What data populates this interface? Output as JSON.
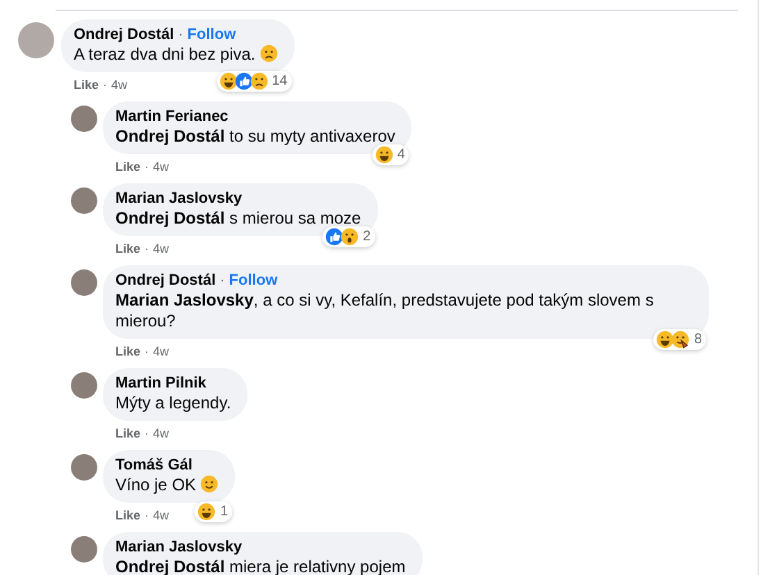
{
  "comment": {
    "author": "Ondrej Dostál",
    "separator": "·",
    "follow": "Follow",
    "text": "A teraz dva dni bez piva.",
    "emoji": {
      "kind": "sad"
    },
    "reactions": [
      {
        "kind": "haha"
      },
      {
        "kind": "like"
      },
      {
        "kind": "sad"
      }
    ],
    "reaction_count": "14",
    "like": "Like",
    "meta_separator": "·",
    "time": "4w",
    "replies": [
      {
        "author": "Martin Ferianec",
        "mention": "Ondrej Dostál",
        "text": "to su myty antivaxerov",
        "reactions": [
          {
            "kind": "haha"
          }
        ],
        "reaction_count": "4",
        "like": "Like",
        "meta_separator": "·",
        "time": "4w"
      },
      {
        "author": "Marian Jaslovsky",
        "mention": "Ondrej Dostál",
        "text": "s mierou sa moze",
        "reactions": [
          {
            "kind": "like"
          },
          {
            "kind": "wow"
          }
        ],
        "reaction_count": "2",
        "like": "Like",
        "meta_separator": "·",
        "time": "4w"
      },
      {
        "author": "Ondrej Dostál",
        "separator": "·",
        "follow": "Follow",
        "mention": "Marian Jaslovsky",
        "text": ", a co si vy, Kefalín, predstavujete pod takým slovem s mierou?",
        "reactions": [
          {
            "kind": "haha"
          },
          {
            "kind": "care"
          }
        ],
        "reaction_count": "8",
        "like": "Like",
        "meta_separator": "·",
        "time": "4w"
      },
      {
        "author": "Martin Pilnik",
        "text": "Mýty a legendy.",
        "like": "Like",
        "meta_separator": "·",
        "time": "4w"
      },
      {
        "author": "Tomáš Gál",
        "text": "Víno je OK",
        "emoji": {
          "kind": "smile"
        },
        "reactions": [
          {
            "kind": "haha"
          }
        ],
        "reaction_count": "1",
        "like": "Like",
        "meta_separator": "·",
        "time": "4w"
      },
      {
        "author": "Marian Jaslovsky",
        "mention": "Ondrej Dostál",
        "text": "miera je relativny pojem"
      }
    ]
  }
}
